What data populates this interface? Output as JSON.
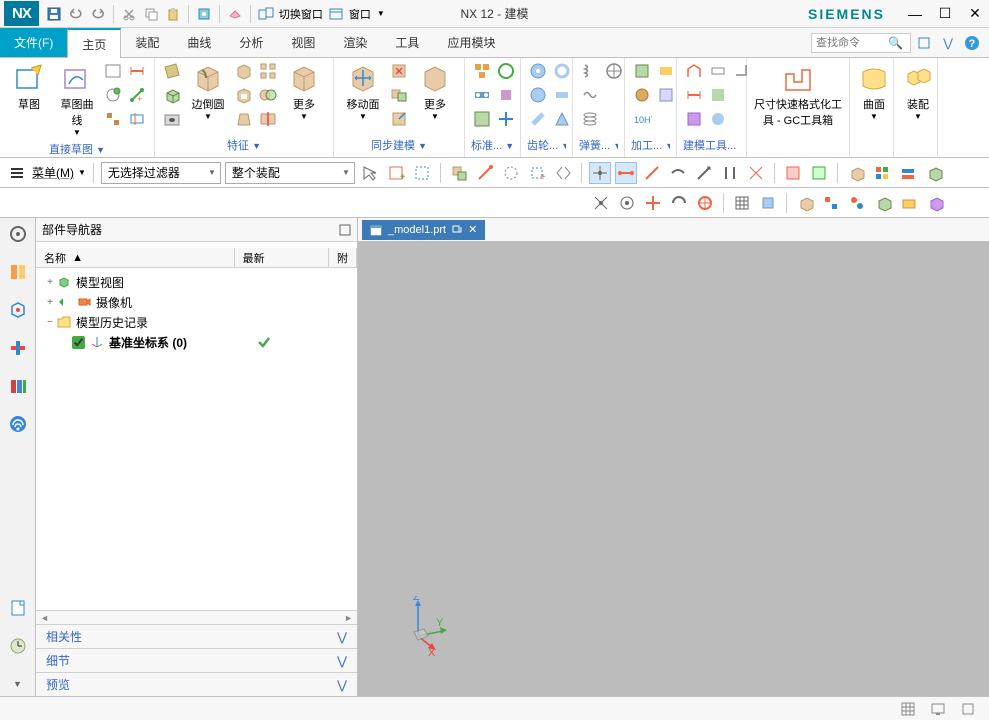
{
  "title": "NX 12 - 建模",
  "brand": "SIEMENS",
  "logo": "NX",
  "qat": {
    "switch_window": "切换窗口",
    "window": "窗口"
  },
  "tabs": {
    "file": "文件(F)",
    "home": "主页",
    "assembly": "装配",
    "curve": "曲线",
    "analysis": "分析",
    "view": "视图",
    "render": "渲染",
    "tool": "工具",
    "app": "应用模块"
  },
  "search_placeholder": "查找命令",
  "ribbon": {
    "groups": {
      "direct_sketch": "直接草图",
      "feature": "特征",
      "sync": "同步建模",
      "standard": "标准...",
      "gear": "齿轮...",
      "spring": "弹簧...",
      "machining": "加工...",
      "model_tools": "建模工具...",
      "size_tool": "尺寸快速格式化工具 - GC工具箱",
      "surface": "曲面",
      "assembly_g": "装配"
    },
    "buttons": {
      "sketch": "草图",
      "sketch_curve": "草图曲线",
      "extrude": "边倒圆",
      "more1": "更多",
      "move_face": "移动面",
      "more2": "更多"
    }
  },
  "sel_bar": {
    "menu": "菜单(M)",
    "filter1": "无选择过滤器",
    "filter2": "整个装配"
  },
  "nav": {
    "title": "部件导航器",
    "col_name": "名称",
    "col_latest": "最新",
    "col_attach": "附",
    "items": {
      "model_view": "模型视图",
      "camera": "摄像机",
      "history": "模型历史记录",
      "datum_csys": "基准坐标系 (0)"
    },
    "sections": {
      "related": "相关性",
      "detail": "细节",
      "preview": "预览"
    }
  },
  "doc_tab": "_model1.prt",
  "axis": {
    "x": "X",
    "y": "Y",
    "z": "Z"
  }
}
